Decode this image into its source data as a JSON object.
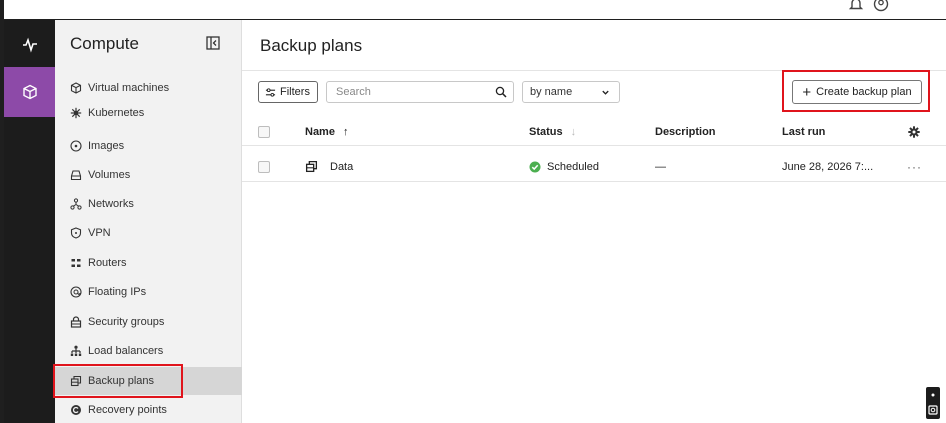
{
  "app": {
    "accent_color": "#8d4aa8",
    "highlight_color": "#e0141c"
  },
  "topbar": {
    "icons": [
      "bell-icon",
      "user-icon"
    ]
  },
  "rail": {
    "items": [
      {
        "icon": "pulse-icon",
        "active": false
      },
      {
        "icon": "cube-icon",
        "active": true
      }
    ]
  },
  "sidebar": {
    "title": "Compute",
    "collapse_icon": "sidebar-collapse-icon",
    "items": [
      {
        "label": "Virtual machines",
        "icon": "cube-icon"
      },
      {
        "label": "Kubernetes",
        "icon": "kubernetes-icon"
      },
      {
        "label": "Images",
        "icon": "disc-icon"
      },
      {
        "label": "Volumes",
        "icon": "drive-icon"
      },
      {
        "label": "Networks",
        "icon": "network-icon"
      },
      {
        "label": "VPN",
        "icon": "shield-icon"
      },
      {
        "label": "Routers",
        "icon": "router-icon"
      },
      {
        "label": "Floating IPs",
        "icon": "globe-icon"
      },
      {
        "label": "Security groups",
        "icon": "lock-icon"
      },
      {
        "label": "Load balancers",
        "icon": "load-balancer-icon"
      },
      {
        "label": "Backup plans",
        "icon": "backup-icon",
        "active": true
      },
      {
        "label": "Recovery points",
        "icon": "recovery-icon"
      }
    ]
  },
  "main": {
    "title": "Backup plans",
    "toolbar": {
      "filters_label": "Filters",
      "search_placeholder": "Search",
      "sort_value": "by name",
      "create_label": "Create backup plan"
    },
    "table": {
      "columns": {
        "name": "Name",
        "status": "Status",
        "description": "Description",
        "last_run": "Last run"
      },
      "rows": [
        {
          "name": "Data",
          "status": "Scheduled",
          "status_color": "#4caf50",
          "description": "—",
          "last_run": "June 28, 2026 7:..."
        }
      ]
    }
  }
}
